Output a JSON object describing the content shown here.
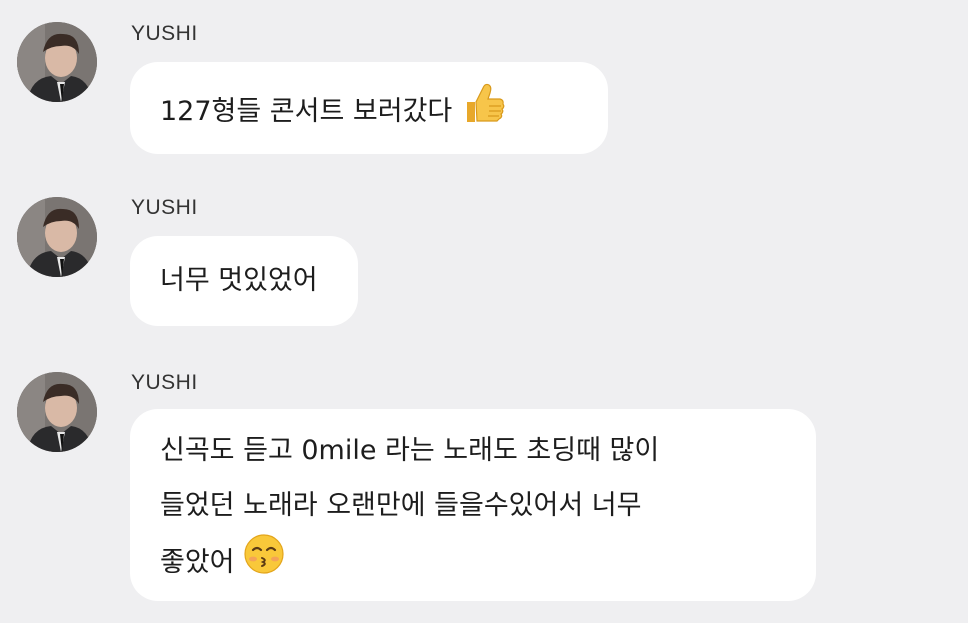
{
  "messages": [
    {
      "sender": "YUSHI",
      "lines": [
        "127형들 콘서트 보러갔다 "
      ],
      "emoji": "thumbs-up-emoji"
    },
    {
      "sender": "YUSHI",
      "lines": [
        "너무 멋있었어"
      ],
      "emoji": ""
    },
    {
      "sender": "YUSHI",
      "lines": [
        "신곡도 듣고 0mile 라는 노래도 초딩때 많이",
        "들었던 노래라 오랜만에 들을수있어서 너무",
        "좋았어 "
      ],
      "emoji": "kissing-face-emoji"
    }
  ],
  "colors": {
    "background": "#efeff1",
    "bubble": "#ffffff",
    "sender_text": "#333333",
    "message_text": "#1d1d1d"
  }
}
